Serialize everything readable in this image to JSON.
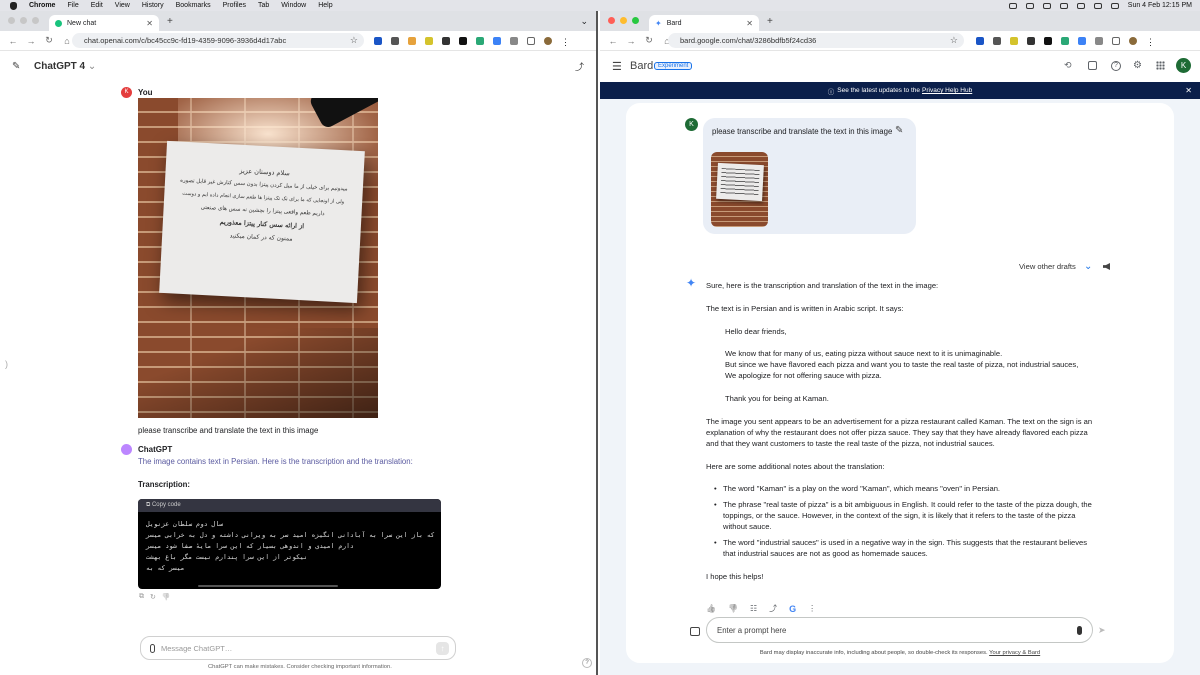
{
  "menubar": {
    "apple": "",
    "app": "Chrome",
    "items": [
      "File",
      "Edit",
      "View",
      "History",
      "Bookmarks",
      "Profiles",
      "Tab",
      "Window",
      "Help"
    ],
    "clock": "Sun 4 Feb  12:15 PM"
  },
  "left": {
    "tab_title": "New chat",
    "url": "chat.openai.com/c/bc45cc9c-fd19-4359-9096-3936d4d17abc",
    "model": "ChatGPT 4",
    "model_chevron": "⌄",
    "user_name": "You",
    "user_avatar": "K",
    "user_message": "please transcribe and translate the text in this image",
    "bot_name": "ChatGPT",
    "bot_intro": "The image contains text in Persian. Here is the transcription and the translation:",
    "transcription_heading": "Transcription:",
    "copy_code": "Copy code",
    "sign_lines": [
      "سلام دوستان عزیز",
      "میدونیم برای خیلی از ما میل کردن پیتزا بدون سس کنارش غیر قابل تصوره",
      "ولی از اونجایی که ما برای تک تک پیتزا ها طعم سازی انجام داده ایم و دوست",
      "داریم طعم واقعی پیتزا را بچشین نه سس های صنعتی",
      "از ارائه سس کنار پیتزا معذوریم",
      "ممنون که در کمان میکنید"
    ],
    "code_lines": [
      "سال دوم سلطان عزنویل",
      "که باز این سرا به آبادانی انگیزه امید سر به ویرانی داشته و دل به خرابی میسر",
      "دارم امیدی و اندوهی بسیار که این سرا مایهٔ صفا شود میسر",
      "نیکوتر از این سرا پندارم نیست مگر باغ بهشت",
      "میسر که به"
    ],
    "input_placeholder": "Message ChatGPT…",
    "footer": "ChatGPT can make mistakes. Consider checking important information.",
    "help": "?"
  },
  "right": {
    "tab_title": "Bard",
    "url": "bard.google.com/chat/3286bdfb5f24cd36",
    "brand": "Bard",
    "badge": "Experiment",
    "account_initial": "K",
    "banner_text_prefix": "See the latest updates to the ",
    "banner_link": "Privacy Help Hub",
    "user_initial": "K",
    "user_prompt": "please transcribe and translate the text in this image",
    "view_drafts": "View other drafts",
    "response": {
      "p1": "Sure, here is the transcription and translation of the text in the image:",
      "p2": "The text is in Persian and is written in Arabic script. It says:",
      "q1": "Hello dear friends,",
      "q2": "We know that for many of us, eating pizza without sauce next to it is unimaginable.",
      "q3": "But since we have flavored each pizza and want you to taste the real taste of pizza, not industrial sauces,",
      "q4": "We apologize for not offering sauce with pizza.",
      "q5": "Thank you for being at Kaman.",
      "p3a": "The image you sent appears to be an advertisement for a pizza restaurant called Kaman. The text on the sign is an",
      "p3b": "explanation of why the restaurant does not offer pizza sauce. They say that they have already flavored each pizza",
      "p3c": "and that they want customers to taste the real taste of the pizza, not industrial sauces.",
      "p4": "Here are some additional notes about the translation:",
      "b1": "The word \"Kaman\" is a play on the word \"Kaman\", which means \"oven\" in Persian.",
      "b2a": "The phrase \"real taste of pizza\" is a bit ambiguous in English. It could refer to the taste of the pizza dough, the",
      "b2b": "toppings, or the sauce. However, in the context of the sign, it is likely that it refers to the taste of the pizza",
      "b2c": "without sauce.",
      "b3a": "The word \"industrial sauces\" is used in a negative way in the sign. This suggests that the restaurant believes",
      "b3b": "that industrial sauces are not as good as homemade sauces.",
      "p5": "I hope this helps!"
    },
    "prompt_placeholder": "Enter a prompt here",
    "footer_text": "Bard may display inaccurate info, including about people, so double-check its responses. ",
    "footer_link": "Your privacy & Bard"
  },
  "icons": {
    "back": "←",
    "forward": "→",
    "reload": "↻",
    "home": "⌂",
    "star": "☆",
    "close": "✕",
    "plus": "+",
    "mic": "🎤",
    "send": "➤",
    "thumbs_up": "👍",
    "thumbs_down": "👎",
    "share": "⤴",
    "more": "⋮",
    "sparkle": "✦",
    "speaker": "🔊",
    "chevron": "⌄",
    "pencil": "✎",
    "menu": "☰",
    "history": "⟲",
    "gear": "⚙",
    "apps": "⋮⋮",
    "clip": "📎",
    "image": "🖼",
    "copy": "⧉",
    "regen": "↻",
    "info": "ⓘ",
    "edit": "✎",
    "tune": "☷"
  },
  "colors": {
    "banner": "#0b1f4a",
    "bard_blue": "#1a73e8",
    "user_avatar_red": "#e43d3d",
    "chatgpt_purple": "#ab68ff",
    "code_bg": "#000000",
    "account_green": "#1e6b35"
  }
}
